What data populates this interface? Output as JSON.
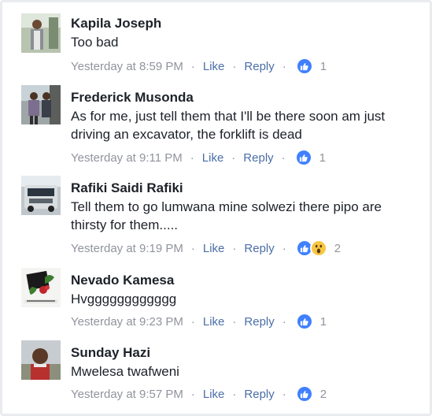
{
  "comments": [
    {
      "name": "Kapila Joseph",
      "text": "Too bad",
      "time": "Yesterday at 8:59 PM",
      "like_label": "Like",
      "reply_label": "Reply",
      "reactions": [
        "like-icon"
      ],
      "reaction_count": "1"
    },
    {
      "name": "Frederick Musonda",
      "text": "As for me, just tell them that I'll be there soon am just driving an excavator, the forklift is dead",
      "time": "Yesterday at 9:11 PM",
      "like_label": "Like",
      "reply_label": "Reply",
      "reactions": [
        "like-icon"
      ],
      "reaction_count": "1"
    },
    {
      "name": "Rafiki Saidi Rafiki",
      "text": "Tell them to go lumwana mine solwezi there pipo are thirsty for them.....",
      "time": "Yesterday at 9:19 PM",
      "like_label": "Like",
      "reply_label": "Reply",
      "reactions": [
        "like-icon",
        "wow-icon"
      ],
      "reaction_count": "2"
    },
    {
      "name": "Nevado Kamesa",
      "text": "Hvgggggggggggg",
      "time": "Yesterday at 9:23 PM",
      "like_label": "Like",
      "reply_label": "Reply",
      "reactions": [
        "like-icon"
      ],
      "reaction_count": "1"
    },
    {
      "name": "Sunday Hazi",
      "text": "Mwelesa twafweni",
      "time": "Yesterday at 9:57 PM",
      "like_label": "Like",
      "reply_label": "Reply",
      "reactions": [
        "like-icon"
      ],
      "reaction_count": "2"
    }
  ],
  "colors": {
    "name": "#1d2129",
    "meta": "#90949c",
    "link": "#4b6ea8",
    "like_badge": "#4080ff",
    "wow_badge": "#f7c744"
  }
}
